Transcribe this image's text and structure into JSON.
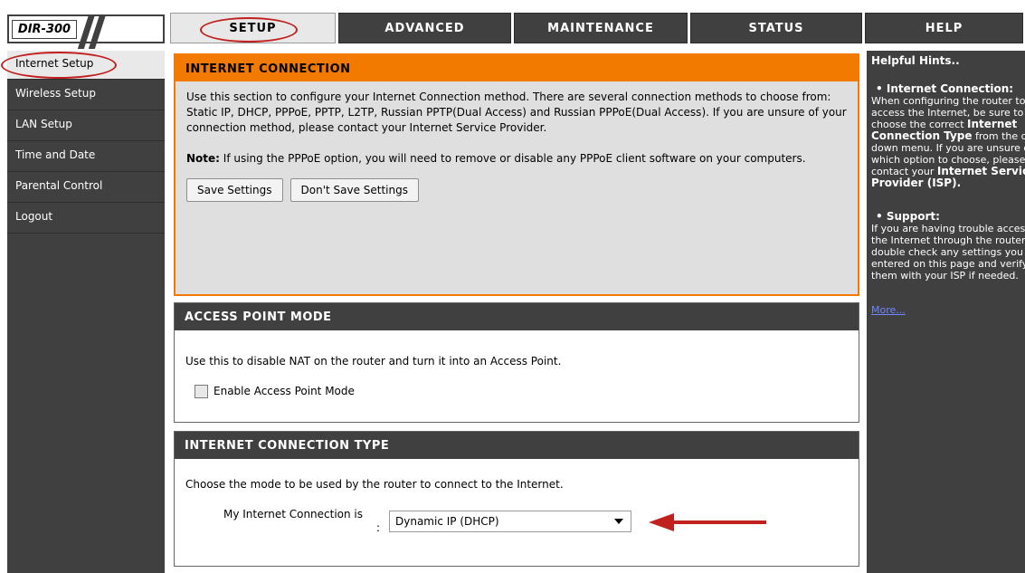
{
  "logo": {
    "text": "DIR-300"
  },
  "tabs": [
    {
      "label": "SETUP"
    },
    {
      "label": "ADVANCED"
    },
    {
      "label": "MAINTENANCE"
    },
    {
      "label": "STATUS"
    },
    {
      "label": "HELP"
    }
  ],
  "sidebar": {
    "items": [
      {
        "label": "Internet Setup"
      },
      {
        "label": "Wireless Setup"
      },
      {
        "label": "LAN Setup"
      },
      {
        "label": "Time and Date"
      },
      {
        "label": "Parental Control"
      },
      {
        "label": "Logout"
      }
    ]
  },
  "internet_connection": {
    "title": "INTERNET CONNECTION",
    "description": "Use this section to configure your Internet Connection method. There are several connection methods to choose from: Static IP, DHCP, PPPoE, PPTP, L2TP, Russian PPTP(Dual Access) and Russian PPPoE(Dual Access). If you are unsure of your connection method, please contact your Internet Service Provider.",
    "note_label": "Note:",
    "note_text": " If using the PPPoE option, you will need to remove or disable any PPPoE client software on your computers.",
    "save_button": "Save Settings",
    "dont_save_button": "Don't Save Settings"
  },
  "access_point": {
    "title": "ACCESS POINT MODE",
    "description": "Use this to disable NAT on the router and turn it into an Access Point.",
    "checkbox_label": "Enable Access Point Mode"
  },
  "connection_type": {
    "title": "INTERNET CONNECTION TYPE",
    "description": "Choose the mode to be used by the router to connect to the Internet.",
    "field_label": "My Internet Connection is",
    "colon": ":",
    "selected_value": "Dynamic IP (DHCP)"
  },
  "hints": {
    "title": "Helpful Hints..",
    "item1_title": "• Internet Connection:",
    "item1_text_a": "When configuring the router to access the Internet, be sure to choose the correct",
    "item1_bold_a": "Internet Connection Type",
    "item1_text_b": "from the drop down menu. If you are unsure of which option to choose, please contact your",
    "item1_bold_b": "Internet Service Provider (ISP).",
    "item2_title": "• Support:",
    "item2_text": "If you are having trouble accessing the Internet through the router, double check any settings you have entered on this page and verify them with your ISP if needed.",
    "more_link": "More..."
  },
  "colors": {
    "dark_gray": "#404040",
    "orange": "#f27a00",
    "panel_gray": "#dfdfdf",
    "highlight_red": "#c0201e",
    "link_blue": "#6e86ff"
  }
}
